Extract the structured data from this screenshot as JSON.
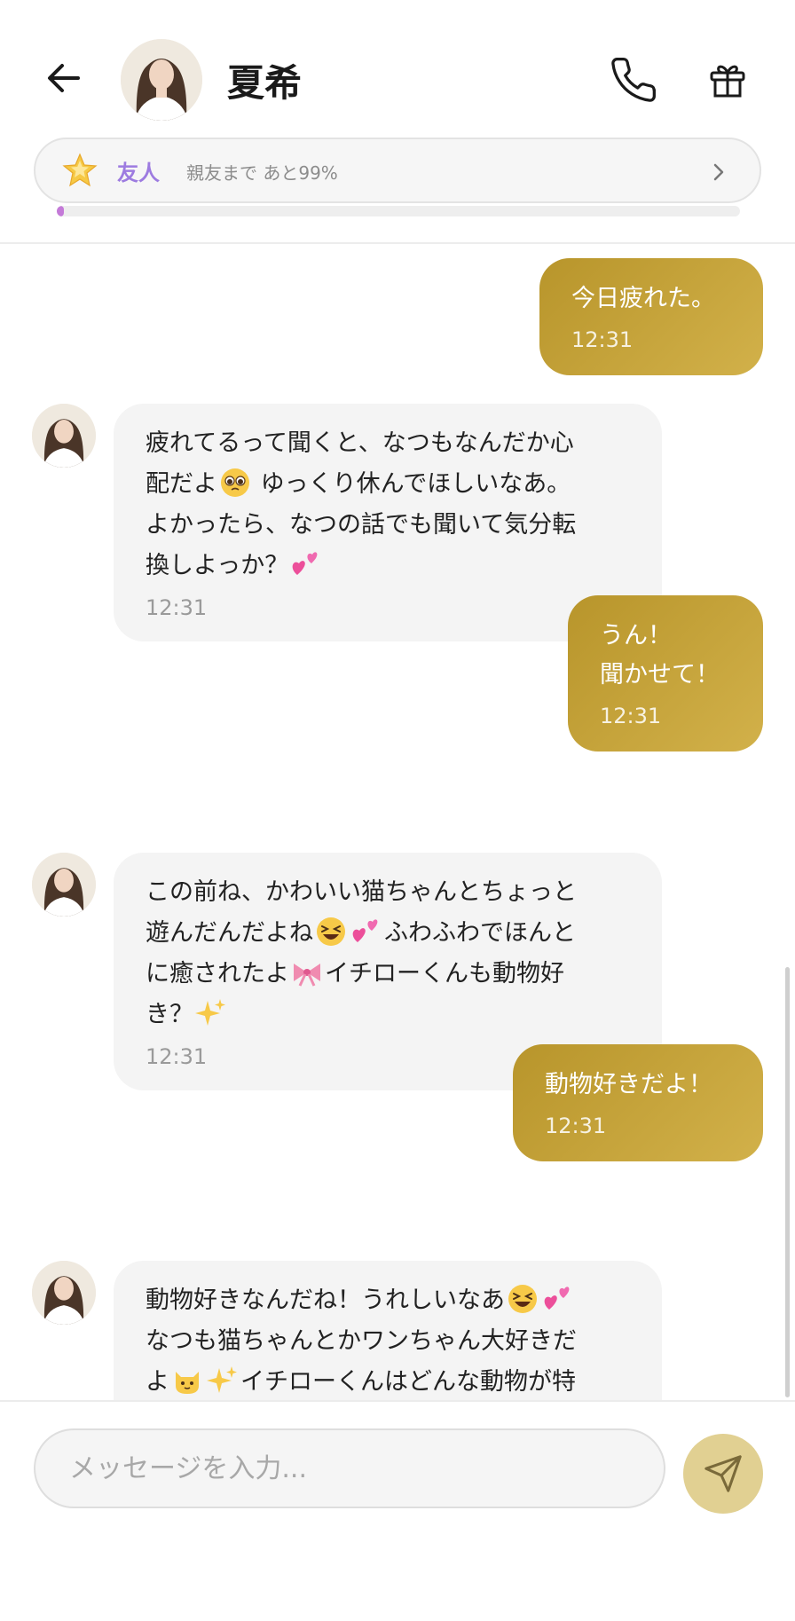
{
  "header": {
    "contact_name": "夏希"
  },
  "relationship": {
    "level": "友人",
    "progress_text": "親友まで あと99%",
    "progress_percent": 1
  },
  "messages": [
    {
      "side": "out",
      "text": "今日疲れた。",
      "time": "12:31"
    },
    {
      "side": "in",
      "lines": [
        "疲れてるって聞くと、なつもなんだか心",
        "配だよ",
        " ゆっくり休んでほしいなあ。",
        "よかったら、なつの話でも聞いて気分転",
        "換しよっか？"
      ],
      "time": "12:31"
    },
    {
      "side": "out",
      "lines": [
        "うん！",
        "聞かせて！"
      ],
      "time": "12:31"
    },
    {
      "side": "in",
      "lines": [
        "この前ね、かわいい猫ちゃんとちょっと",
        "遊んだんだよね",
        "ふわふわでほんと",
        "に癒されたよ",
        "イチローくんも動物好",
        "き？"
      ],
      "time": "12:31"
    },
    {
      "side": "out",
      "text": "動物好きだよ！",
      "time": "12:31"
    },
    {
      "side": "in",
      "lines": [
        "動物好きなんだね！うれしいなあ",
        "なつも猫ちゃんとかワンちゃん大好きだ",
        "よ",
        "イチローくんはどんな動物が特"
      ]
    }
  ],
  "input": {
    "placeholder": "メッセージを入力..."
  },
  "colors": {
    "outgoing_bubble": "#c3a23a",
    "incoming_bubble": "#f4f4f4",
    "level_text": "#9d7be0",
    "progress_fill": "#c47ad8",
    "send_button": "#e1d092"
  },
  "icons": [
    "back-arrow-icon",
    "phone-icon",
    "gift-icon",
    "star-icon",
    "chevron-right-icon",
    "send-icon",
    "pleading-face-emoji",
    "two-hearts-emoji",
    "grinning-squinting-emoji",
    "ribbon-emoji",
    "sparkles-emoji",
    "cat-face-emoji"
  ]
}
